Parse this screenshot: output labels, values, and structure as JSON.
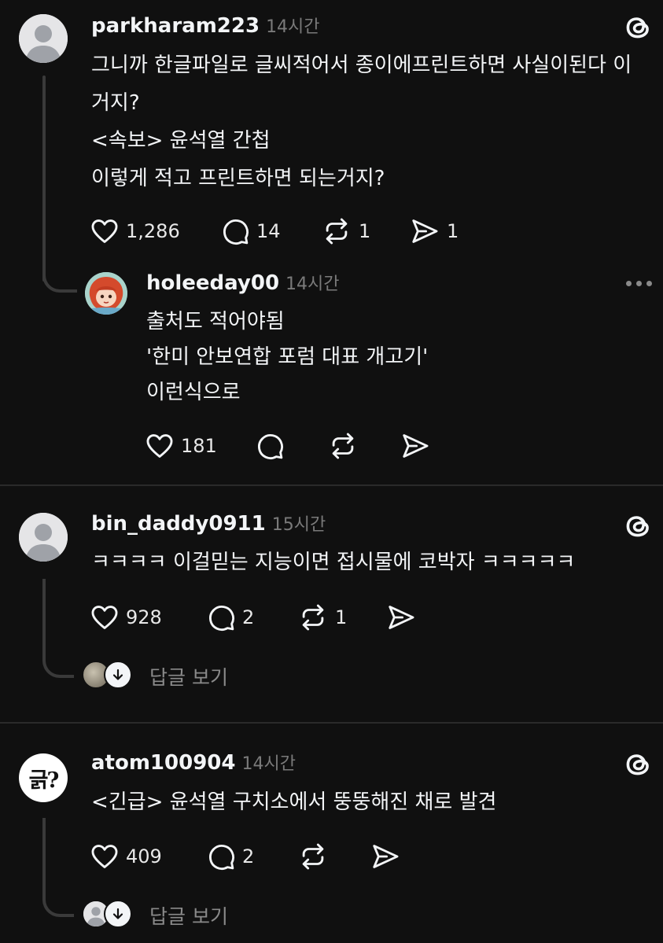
{
  "posts": [
    {
      "username": "parkharam223",
      "time": "14시간",
      "lines": [
        "그니까 한글파일로 글씨적어서 종이에프린트하면 사실이된다 이",
        "거지?",
        "<속보> 윤석열 간첩",
        "이렇게 적고 프린트하면 되는거지?"
      ],
      "likes": "1,286",
      "comments": "14",
      "reposts": "1",
      "shares": "1"
    },
    {
      "username": "bin_daddy0911",
      "time": "15시간",
      "lines": [
        "ㅋㅋㅋㅋ 이걸믿는 지능이면 접시물에 코박자 ㅋㅋㅋㅋㅋ"
      ],
      "likes": "928",
      "comments": "2",
      "reposts": "1",
      "view_replies": "답글 보기"
    },
    {
      "username": "atom100904",
      "avatar_text": "긁?",
      "time": "14시간",
      "lines": [
        "<긴급> 윤석열 구치소에서 뚱뚱해진 채로 발견"
      ],
      "likes": "409",
      "comments": "2",
      "view_replies": "답글 보기"
    }
  ],
  "reply": {
    "username": "holeeday00",
    "time": "14시간",
    "lines": [
      "출처도 적어야됨",
      "'한미 안보연합 포럼 대표 개고기'",
      "이런식으로"
    ],
    "likes": "181"
  },
  "icons": {
    "threads": "threads-logo-icon",
    "like": "heart-icon",
    "comment": "comment-bubble-icon",
    "repost": "repost-icon",
    "share": "send-icon",
    "more": "more-dots-icon",
    "arrow": "arrow-down-icon"
  },
  "colors": {
    "background": "#101010",
    "text": "#f3f5f7",
    "muted": "#7a7a7a",
    "divider": "#2a2a2a"
  }
}
